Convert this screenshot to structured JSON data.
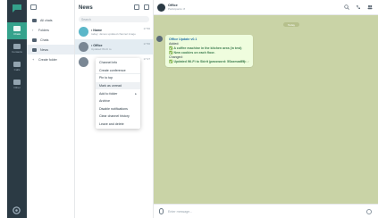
{
  "rail": {
    "items": [
      {
        "label": "Chats",
        "active": true
      },
      {
        "label": "Contacts",
        "active": false
      },
      {
        "label": "Calls",
        "active": false
      },
      {
        "label": "Other",
        "active": false
      }
    ]
  },
  "folders": {
    "all_chats": "All chats",
    "items": [
      {
        "label": "Folders",
        "icon": "chevron-icon",
        "active": false
      },
      {
        "label": "Chats",
        "icon": "folder-icon",
        "active": false
      },
      {
        "label": "News",
        "icon": "folder-icon",
        "active": true
      },
      {
        "label": "Create folder",
        "icon": "plus-icon",
        "active": false
      }
    ]
  },
  "chatlist": {
    "title": "News",
    "search_placeholder": "Search",
    "items": [
      {
        "name": "• Name",
        "preview": "today: James updated channel image",
        "time": "17:56"
      },
      {
        "name": "• Office",
        "preview": "Updated Wi-Fi to",
        "time": "17:56"
      },
      {
        "name": "",
        "preview": "",
        "time": "17:27"
      }
    ]
  },
  "context_menu": {
    "items": [
      {
        "label": "Channel info"
      },
      {
        "label": "Create conference"
      },
      {
        "label": "Pin to top"
      },
      {
        "label": "Mark as unread"
      },
      {
        "label": "Add to folder",
        "arrow": "▸"
      },
      {
        "label": "Archive"
      },
      {
        "label": "Disable notifications"
      },
      {
        "label": "Clear channel history"
      },
      {
        "label": "Leave and delete"
      }
    ]
  },
  "chat": {
    "title": "Office",
    "subtitle": "Participants: 8",
    "date_pill": "Today",
    "message": {
      "header": "Office Update v0.1",
      "lines": [
        "Added:",
        "✅ A coffee machine in the kitchen area (in test)",
        "✅ New cookies on each floor.",
        "Changed:",
        "✅ Updated Wi-Fi to Skirit (password: 5Saxmar55)"
      ],
      "time": "17:56 ✓"
    },
    "composer_placeholder": "Enter message..."
  }
}
